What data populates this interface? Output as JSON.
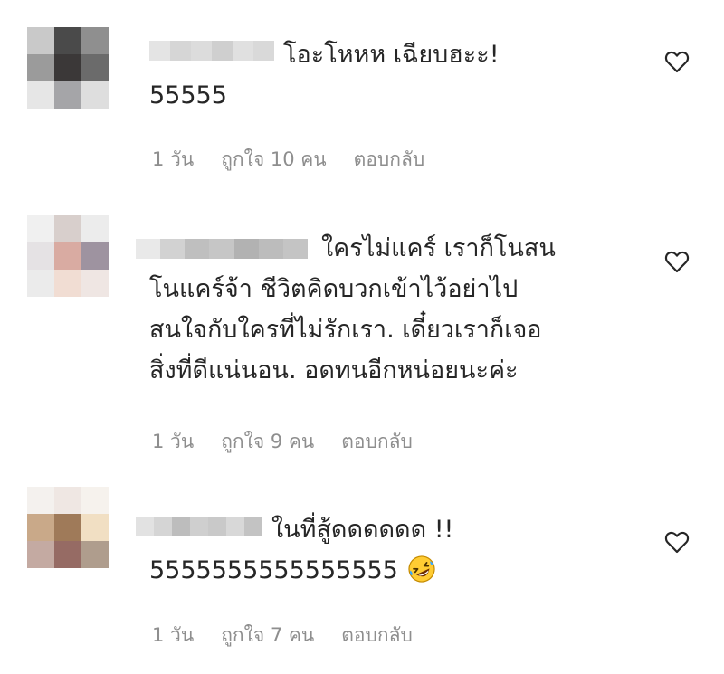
{
  "comments": [
    {
      "lines": [
        "โอะโหหห เฉียบฮะะ!",
        "55555"
      ],
      "meta": {
        "time": "1 วัน",
        "likes": "ถูกใจ 10 คน",
        "reply": "ตอบกลับ"
      },
      "avatar_colors": [
        "#c9c9c9",
        "#4a4a4a",
        "#8f8f8f",
        "#9b9b9b",
        "#3b3838",
        "#6b6b6b",
        "#e6e6e6",
        "#a5a5a8",
        "#dedede"
      ],
      "name_blur_colors": [
        "#e4e4e4",
        "#d6d6d6",
        "#dcdcdc",
        "#cfcfcf",
        "#e0e0e0",
        "#d9d9d9"
      ]
    },
    {
      "lines": [
        "ใครไม่แคร์ เราก็โนสน",
        "โนแคร์จ้า ชีวิตคิดบวกเข้าไว้อย่าไป",
        "สนใจกับใครที่ไม่รักเรา. เดี๋ยวเราก็เจอ",
        "สิ่งที่ดีแน่นอน. อดทนอีกหน่อยนะค่ะ"
      ],
      "meta": {
        "time": "1 วัน",
        "likes": "ถูกใจ 9 คน",
        "reply": "ตอบกลับ"
      },
      "avatar_colors": [
        "#f0f0f0",
        "#d8cfcc",
        "#ececec",
        "#e5e2e4",
        "#d9aba2",
        "#9e93a0",
        "#ebebeb",
        "#f1ddd3",
        "#efe6e3"
      ],
      "name_blur_colors": [
        "#e9e9e9",
        "#d2d2d2",
        "#bfbfbf",
        "#c6c6c6",
        "#b2b2b2",
        "#bcbcbc",
        "#c4c4c4"
      ]
    },
    {
      "lines": [
        "ในที่สู้ดดดดดด !!",
        "5555555555555555"
      ],
      "meta": {
        "time": "1 วัน",
        "likes": "ถูกใจ 7 คน",
        "reply": "ตอบกลับ"
      },
      "avatar_colors": [
        "#f4f1ee",
        "#efe7e3",
        "#f6f2ed",
        "#c9a989",
        "#9f7a59",
        "#f1dfc3",
        "#c4aaa2",
        "#966b64",
        "#af9d8d"
      ],
      "name_blur_colors": [
        "#e2e2e2",
        "#d5d5d5",
        "#bdbdbd",
        "#cfcfcf",
        "#c9c9c9",
        "#d8d8d8",
        "#c3c3c3"
      ]
    }
  ]
}
